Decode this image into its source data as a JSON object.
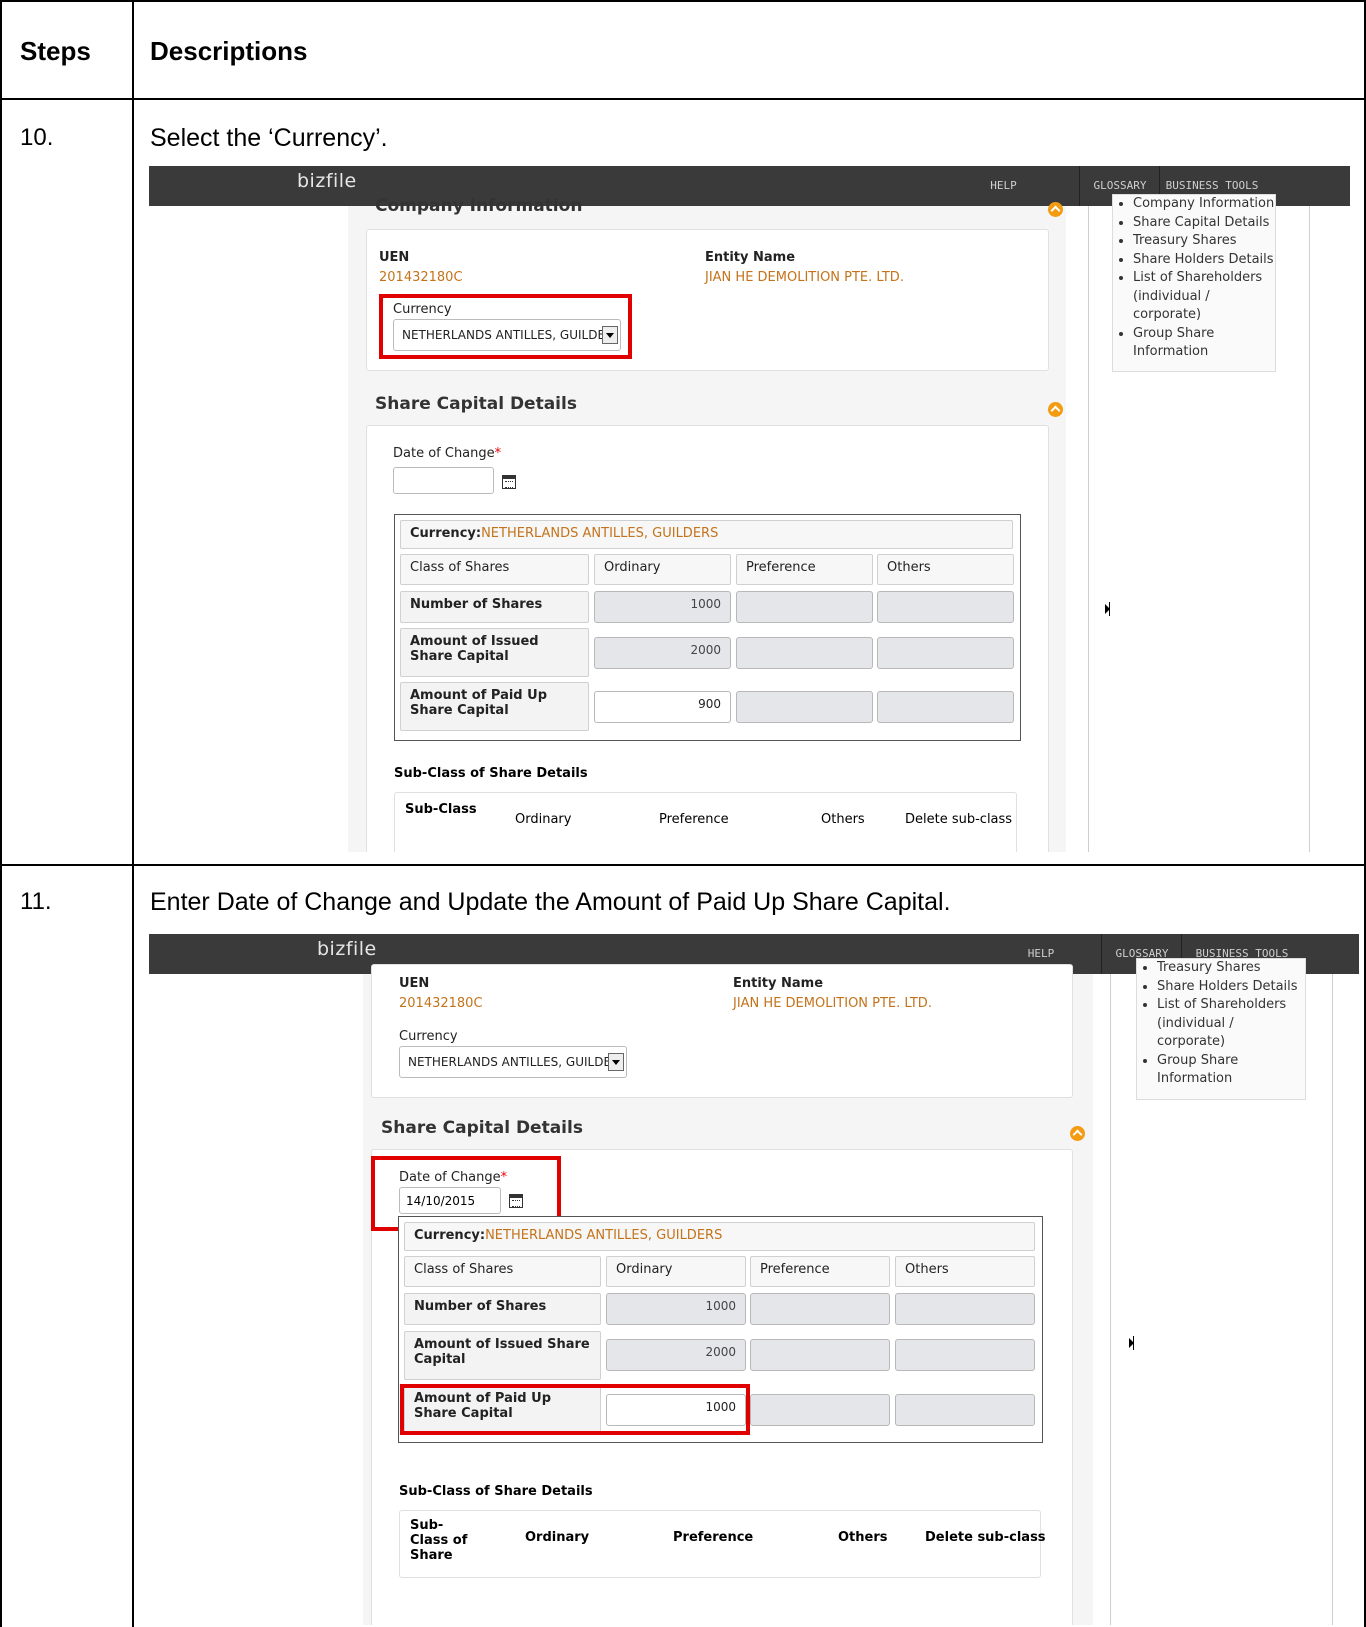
{
  "table_header": {
    "steps": "Steps",
    "descriptions": "Descriptions"
  },
  "steps": [
    {
      "number": "10.",
      "description": "Select the ‘Currency’.",
      "shot": {
        "logo": "bizfile",
        "nav": [
          "HELP",
          "GLOSSARY",
          "BUSINESS TOOLS"
        ],
        "sidebar_links": [
          "Company Information",
          "Share Capital Details",
          "Treasury Shares",
          "Share Holders Details",
          "List of Shareholders (individual / corporate)",
          "Group Share Information"
        ],
        "section_company": "Company Information",
        "uen_label": "UEN",
        "uen_value": "201432180C",
        "entity_label": "Entity Name",
        "entity_value": "JIAN HE DEMOLITION PTE. LTD.",
        "currency_label": "Currency",
        "currency_value": "NETHERLANDS ANTILLES, GUILDER",
        "section_share": "Share Capital Details",
        "date_label": "Date of Change",
        "date_required": "*",
        "date_value": "",
        "table_currency_label": "Currency:",
        "table_currency_value": "NETHERLANDS ANTILLES, GUILDERS",
        "columns": [
          "Class of Shares",
          "Ordinary",
          "Preference",
          "Others"
        ],
        "rows": [
          {
            "label": "Number of Shares",
            "ordinary": "1000"
          },
          {
            "label": "Amount of Issued Share Capital",
            "ordinary": "2000"
          },
          {
            "label": "Amount of Paid Up Share Capital",
            "ordinary": "900"
          }
        ],
        "subclass_title": "Sub-Class of Share Details",
        "subclass_columns": [
          "Sub-Class",
          "Ordinary",
          "Preference",
          "Others",
          "Delete sub-class"
        ]
      }
    },
    {
      "number": "11.",
      "description": "Enter Date of Change and Update the Amount of Paid Up Share Capital.",
      "shot": {
        "logo": "bizfile",
        "nav": [
          "HELP",
          "GLOSSARY",
          "BUSINESS TOOLS"
        ],
        "sidebar_links": [
          "Treasury Shares",
          "Share Holders Details",
          "List of Shareholders (individual / corporate)",
          "Group Share Information"
        ],
        "uen_label": "UEN",
        "uen_value": "201432180C",
        "entity_label": "Entity Name",
        "entity_value": "JIAN HE DEMOLITION PTE. LTD.",
        "currency_label": "Currency",
        "currency_value": "NETHERLANDS ANTILLES, GUILDER",
        "section_share": "Share Capital Details",
        "date_label": "Date of Change",
        "date_required": "*",
        "date_value": "14/10/2015",
        "table_currency_label": "Currency:",
        "table_currency_value": "NETHERLANDS ANTILLES, GUILDERS",
        "columns": [
          "Class of Shares",
          "Ordinary",
          "Preference",
          "Others"
        ],
        "rows": [
          {
            "label": "Number of Shares",
            "ordinary": "1000"
          },
          {
            "label": "Amount of Issued Share Capital",
            "ordinary": "2000"
          },
          {
            "label": "Amount of Paid Up Share Capital",
            "ordinary": "1000"
          }
        ],
        "subclass_title": "Sub-Class of Share Details",
        "subclass_columns": [
          "Sub-Class of Share",
          "Ordinary",
          "Preference",
          "Others",
          "Delete sub-class"
        ]
      }
    }
  ]
}
